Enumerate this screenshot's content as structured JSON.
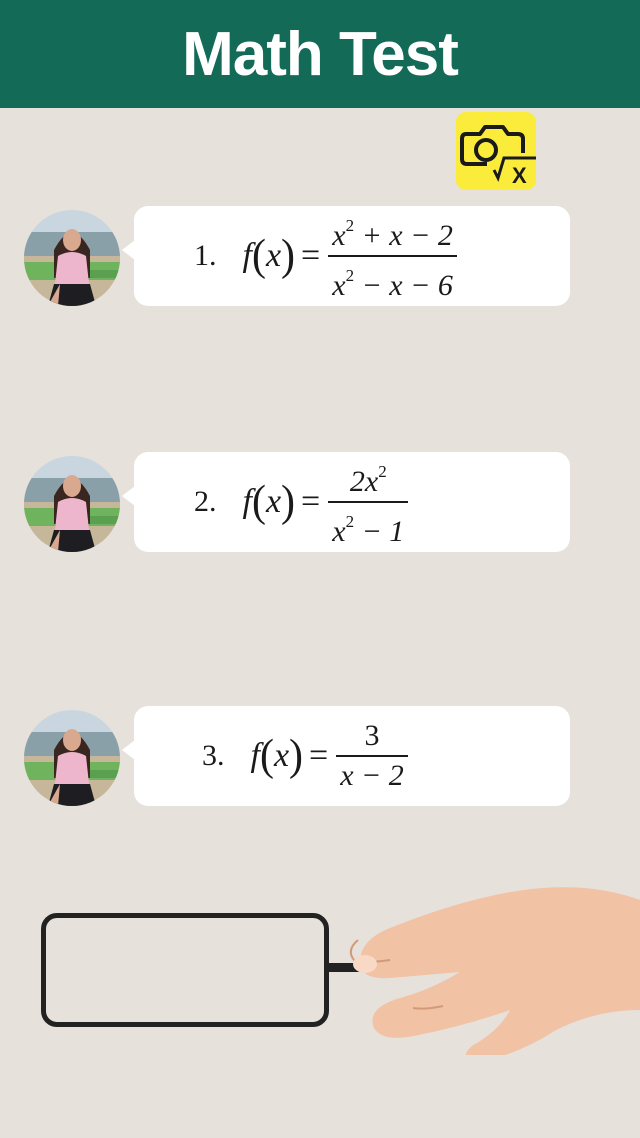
{
  "header": {
    "title": "Math Test"
  },
  "camera": {
    "icon": "camera-sqrt-x-icon",
    "glyph": "√x",
    "color": "#fbec3c"
  },
  "colors": {
    "header_bg": "#136a57",
    "background": "#e6e1db",
    "bubble": "#ffffff"
  },
  "questions": [
    {
      "number": "1.",
      "lhs_f": "f",
      "lhs_x": "x",
      "equals": "=",
      "numerator": {
        "v1": "x",
        "e1": "2",
        "rest": " + x − 2"
      },
      "denominator": {
        "v1": "x",
        "e1": "2",
        "rest": " − x − 6"
      }
    },
    {
      "number": "2.",
      "lhs_f": "f",
      "lhs_x": "x",
      "equals": "=",
      "numerator": {
        "pre": "2x",
        "e1": "2"
      },
      "denominator": {
        "v1": "x",
        "e1": "2",
        "rest": " − 1"
      }
    },
    {
      "number": "3.",
      "lhs_f": "f",
      "lhs_x": "x",
      "equals": "=",
      "numerator": {
        "value": "3"
      },
      "denominator": {
        "value": "x − 2"
      }
    }
  ],
  "answer": {
    "value": ""
  }
}
